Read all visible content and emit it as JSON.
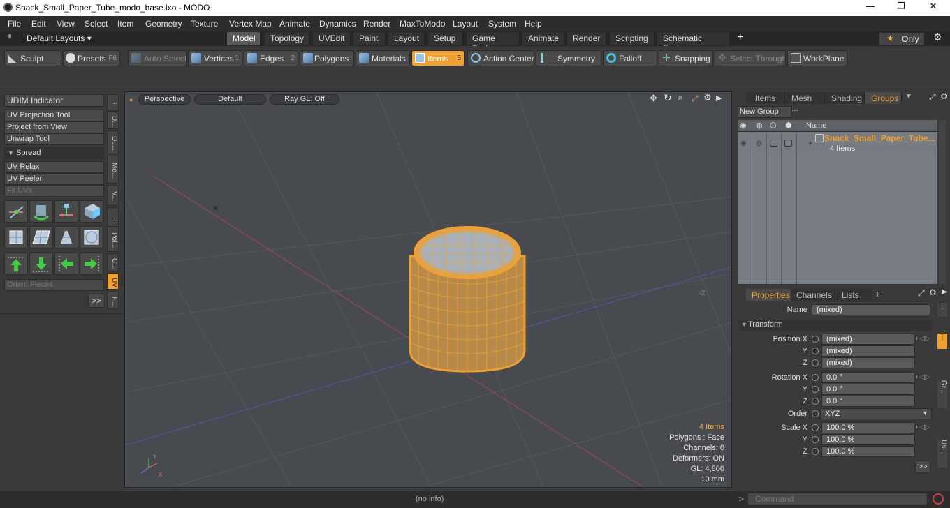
{
  "window": {
    "title": "Snack_Small_Paper_Tube_modo_base.lxo - MODO",
    "minimize": "—",
    "maximize": "❐",
    "close": "✕"
  },
  "menu": [
    "File",
    "Edit",
    "View",
    "Select",
    "Item",
    "Geometry",
    "Texture",
    "Vertex Map",
    "Animate",
    "Dynamics",
    "Render",
    "MaxToModo",
    "Layout",
    "System",
    "Help"
  ],
  "layout_bar": {
    "default_layouts": "Default Layouts ▾",
    "tabs": [
      "Model",
      "Topology",
      "UVEdit",
      "Paint",
      "Layout",
      "Setup",
      "Game Tools",
      "Animate",
      "Render",
      "Scripting",
      "Schematic Fusion"
    ],
    "active_tab": "Model",
    "plus": "+",
    "only": "Only",
    "star": "★"
  },
  "toolbar": {
    "sculpt": "Sculpt",
    "presets": "Presets",
    "presets_key": "F6",
    "auto_select": "Auto Select",
    "vertices": "Vertices",
    "vertices_num": "1",
    "edges": "Edges",
    "edges_num": "2",
    "polygons": "Polygons",
    "materials": "Materials",
    "items": "Items",
    "items_num": "5",
    "action_center": "Action Center",
    "symmetry": "Symmetry",
    "falloff": "Falloff",
    "snapping": "Snapping",
    "select_through": "Select Through",
    "workplane": "WorkPlane"
  },
  "left_panel": {
    "udim": "UDIM Indicator",
    "uv_projection": "UV Projection Tool",
    "project_from_view": "Project from View",
    "unwrap_tool": "Unwrap Tool",
    "spread": "Spread",
    "uv_relax": "UV Relax",
    "uv_peeler": "UV Peeler",
    "fit_uvs": "Fit UVs",
    "orient_pieces": "Orient Pieces",
    "more": ">>",
    "vtabs": [
      "D...",
      "Du...",
      "Me...",
      "V...",
      "Pol...",
      "C...",
      "UV",
      "F..."
    ]
  },
  "viewport": {
    "perspective": "Perspective",
    "default": "Default",
    "raygl": "Ray GL: Off",
    "info": {
      "items": "4 Items",
      "polygons": "Polygons : Face",
      "channels": "Channels: 0",
      "deformers": "Deformers: ON",
      "gl": "GL: 4,800",
      "scale": "10 mm"
    },
    "axis_y": "Y",
    "axis_x": "X",
    "z_label": "-Z"
  },
  "groups_panel": {
    "tabs": [
      "Items",
      "Mesh ...",
      "Shading",
      "Groups"
    ],
    "active": "Groups",
    "new_group": "New Group",
    "col_name": "Name",
    "row_name": "Snack_Small_Paper_Tube...",
    "row_sub": "4 Items"
  },
  "properties": {
    "tabs": [
      "Properties",
      "Channels",
      "Lists"
    ],
    "name_label": "Name",
    "name_value": "(mixed)",
    "transform": "Transform",
    "position_x_label": "Position X",
    "y_label": "Y",
    "z_label": "Z",
    "pos_x": "(mixed)",
    "pos_y": "(mixed)",
    "pos_z": "(mixed)",
    "rotation_x_label": "Rotation X",
    "rot_x": "0.0 °",
    "rot_y": "0.0 °",
    "rot_z": "0.0 °",
    "order_label": "Order",
    "order_value": "XYZ",
    "scale_x_label": "Scale X",
    "scale_x": "100.0 %",
    "scale_y": "100.0 %",
    "scale_z": "100.0 %",
    "more": ">>",
    "side_tabs": [
      "Gr...",
      "Us..."
    ]
  },
  "status": {
    "info": "(no info)",
    "command_prompt": ">",
    "command_placeholder": "Command"
  },
  "colors": {
    "accent": "#f0a030",
    "bg": "#3a3a3a",
    "viewport": "#474a4e"
  }
}
